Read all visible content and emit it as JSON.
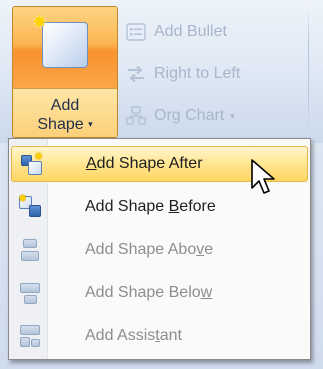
{
  "ribbon": {
    "split_button": {
      "label_line1": "Add",
      "label_line2": "Shape",
      "caret": "▾",
      "icon": "add-shape-icon"
    },
    "commands": [
      {
        "label": "Add Bullet",
        "icon": "bullet-list-icon",
        "enabled": false
      },
      {
        "label": "Right to Left",
        "icon": "right-to-left-arrows-icon",
        "enabled": false
      },
      {
        "label": "Org Chart",
        "icon": "org-chart-icon",
        "enabled": false,
        "caret": "▾"
      }
    ]
  },
  "menu": {
    "items": [
      {
        "pre": "",
        "access": "A",
        "post": "dd Shape After",
        "icon": "add-shape-after-icon",
        "enabled": true,
        "highlighted": true
      },
      {
        "pre": "Add Shape ",
        "access": "B",
        "post": "efore",
        "icon": "add-shape-before-icon",
        "enabled": true,
        "highlighted": false
      },
      {
        "pre": "Add Shape Abo",
        "access": "v",
        "post": "e",
        "icon": "add-shape-above-icon",
        "enabled": false,
        "highlighted": false
      },
      {
        "pre": "Add Shape Belo",
        "access": "w",
        "post": "",
        "icon": "add-shape-below-icon",
        "enabled": false,
        "highlighted": false
      },
      {
        "pre": "Add Assis",
        "access": "t",
        "post": "ant",
        "icon": "add-assistant-icon",
        "enabled": false,
        "highlighted": false
      }
    ]
  },
  "colors": {
    "highlight": "#ffe795",
    "disabled_text": "#8d8d8d",
    "split_button_orange": "#f7922f"
  }
}
